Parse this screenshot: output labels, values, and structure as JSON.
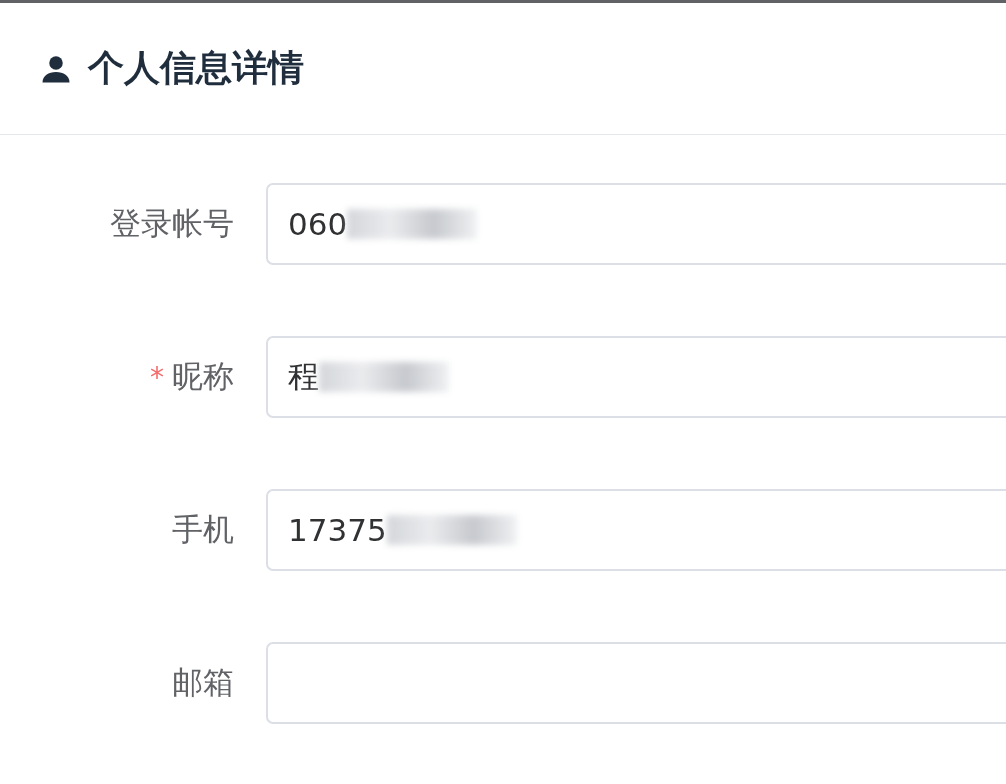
{
  "header": {
    "title": "个人信息详情"
  },
  "fields": [
    {
      "label": "登录帐号",
      "value": "060",
      "redacted": true
    },
    {
      "label": "昵称",
      "value": "程",
      "marker": "*",
      "redacted": true
    },
    {
      "label": "手机",
      "value": "17375",
      "redacted": true
    },
    {
      "label": "邮箱",
      "redacted": false
    }
  ]
}
